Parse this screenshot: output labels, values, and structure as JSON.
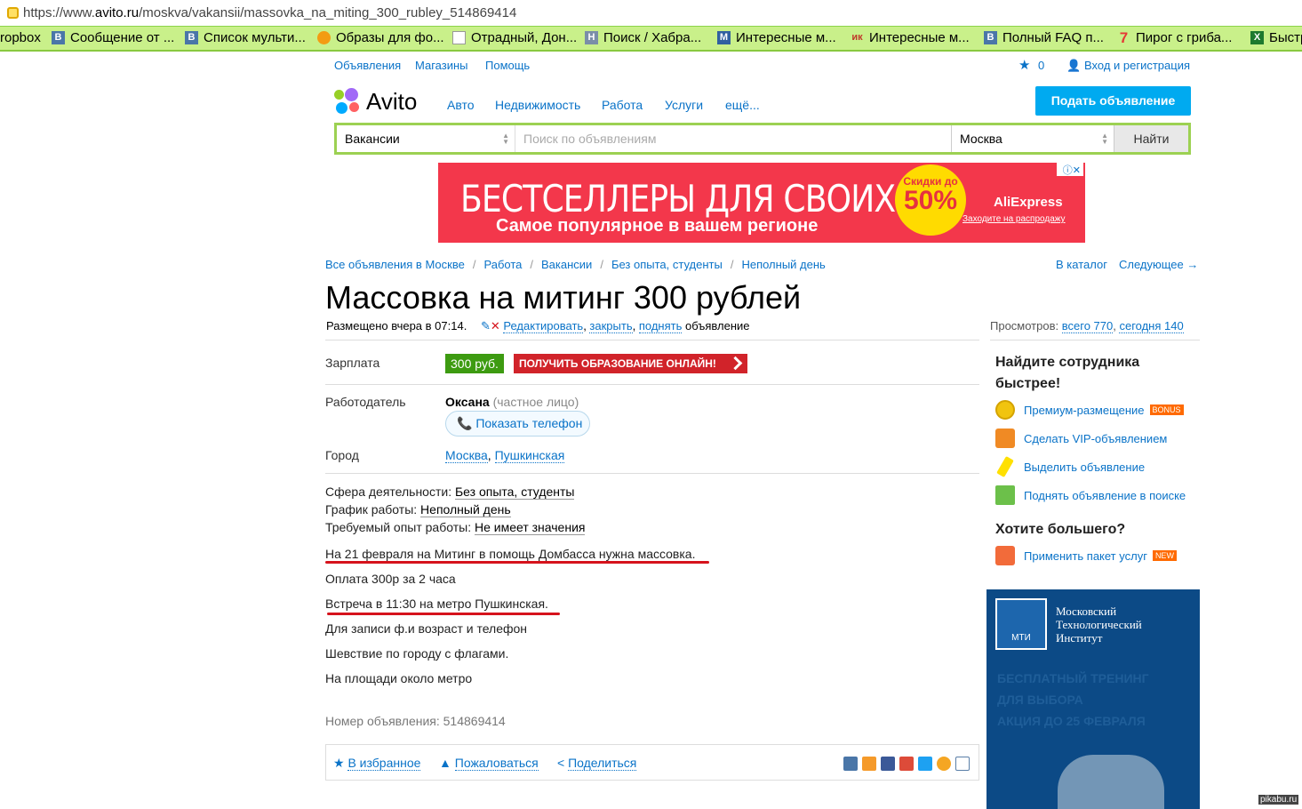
{
  "browser": {
    "url_prefix": "https://www.",
    "url_domain": "avito.ru",
    "url_path": "/moskva/vakansii/massovka_na_miting_300_rubley_514869414"
  },
  "bookmarks": [
    "ropbox",
    "Сообщение от ...",
    "Список мульти...",
    "Образы для фо...",
    "Отрадный, Дон...",
    "Поиск / Хабра...",
    "Интересные м...",
    "Интересные м...",
    "Полный FAQ п...",
    "Пирог с гриба...",
    "Быстр"
  ],
  "topnav": {
    "ads": "Объявления",
    "shops": "Магазины",
    "help": "Помощь",
    "fav_count": "0",
    "login": "Вход и регистрация"
  },
  "logo": {
    "name": "Avito"
  },
  "mainnav": [
    "Авто",
    "Недвижимость",
    "Работа",
    "Услуги",
    "ещё..."
  ],
  "post_button": "Подать объявление",
  "search": {
    "category": "Вакансии",
    "placeholder": "Поиск по объявлениям",
    "city": "Москва",
    "button": "Найти"
  },
  "banner": {
    "title": "БЕСТСЕЛЛЕРЫ ДЛЯ СВОИХ",
    "subtitle": "Самое популярное в вашем регионе",
    "discount_label": "Скидки до",
    "discount": "50%",
    "brand": "AliExpress",
    "cta": "Заходите на распродажу"
  },
  "breadcrumbs": [
    "Все объявления в Москве",
    "Работа",
    "Вакансии",
    "Без опыта, студенты",
    "Неполный день"
  ],
  "catalog": "В каталог",
  "next": "Следующее →",
  "ad": {
    "title": "Массовка на митинг 300 рублей",
    "posted": "Размещено вчера в 07:14.",
    "edit": "Редактировать",
    "close": "закрыть",
    "raise": "поднять",
    "ad_word": "объявление",
    "views_label": "Просмотров:",
    "views_total": "всего 770",
    "views_today": "сегодня 140",
    "salary_label": "Зарплата",
    "salary": "300 руб.",
    "edu_banner": "ПОЛУЧИТЬ ОБРАЗОВАНИЕ ОНЛАЙН!",
    "employer_label": "Работодатель",
    "employer": "Оксана",
    "employer_type": "(частное лицо)",
    "show_phone": "Показать телефон",
    "city_label": "Город",
    "city": "Москва",
    "metro": "Пушкинская",
    "sphere_label": "Сфера деятельности:",
    "sphere": "Без опыта, студенты",
    "schedule_label": "График работы:",
    "schedule": "Неполный день",
    "exp_label": "Требуемый опыт работы:",
    "exp": "Не имеет значения",
    "description": [
      "На 21 февраля на Митинг в помощь Домбасса нужна массовка.",
      "Оплата 300р за 2 часа",
      "Встреча в 11:30 на метро Пушкинская.",
      "Для записи ф.и возраст и телефон",
      "Шевствие по городу с флагами.",
      "На площади около метро"
    ],
    "number_label": "Номер объявления:",
    "number": "514869414"
  },
  "actions": {
    "fav": "В избранное",
    "report": "Пожаловаться",
    "share": "Поделиться"
  },
  "sidebar": {
    "h1a": "Найдите сотрудника",
    "h1b": "быстрее!",
    "items": [
      "Премиум-размещение",
      "Сделать VIP-объявлением",
      "Выделить объявление",
      "Поднять объявление в поиске"
    ],
    "bonus": "BONUS",
    "h2": "Хотите большего?",
    "package": "Применить пакет услуг",
    "new": "NEW"
  },
  "mti": {
    "logo": "МТИ",
    "name": "Московский Технологический Институт",
    "faded1": "БЕСПЛАТНЫЙ ТРЕНИНГ",
    "faded2": "ДЛЯ ВЫБОРА",
    "faded3": "АКЦИЯ ДО 25 ФЕВРАЛЯ"
  },
  "watermark": "pikabu.ru",
  "colors": {
    "link": "#0a73c8",
    "green_bar": "#9cd152",
    "post_btn": "#00aaf0",
    "salary": "#3d9b11",
    "underline": "#d6131c"
  }
}
